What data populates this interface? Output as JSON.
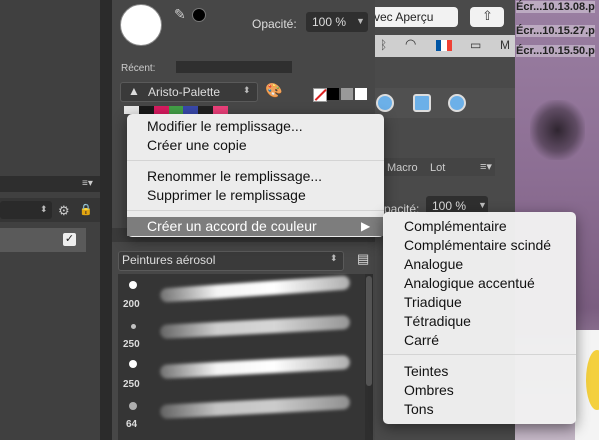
{
  "color_panel": {
    "opacity_label": "Opacité:",
    "opacity_value": "100 %",
    "recent_label": "Récent:",
    "palette_name": "Aristo-Palette",
    "palette_colors": [
      "#e8e8e8",
      "#1a1a1a",
      "#d81b60",
      "#43a047",
      "#3949ab",
      "#212121",
      "#ec407a"
    ]
  },
  "context_menu": {
    "items": [
      "Modifier le remplissage...",
      "Créer une copie",
      "Renommer le remplissage...",
      "Supprimer le remplissage",
      "Créer un accord de couleur"
    ]
  },
  "harmony_submenu": {
    "items": [
      "Complémentaire",
      "Complémentaire scindé",
      "Analogue",
      "Analogique accentué",
      "Triadique",
      "Tétradique",
      "Carré",
      "Teintes",
      "Ombres",
      "Tons"
    ]
  },
  "brushes": {
    "category": "Peintures aérosol",
    "sizes": [
      "200",
      "250",
      "250",
      "64"
    ]
  },
  "right_panel": {
    "preview_button": "vec Aperçu",
    "tabs": [
      "Macro",
      "Lot"
    ],
    "opacity_label": "pacité:",
    "opacity_value": "100 %"
  },
  "desktop": {
    "files": [
      "Écr...10.13.08.p",
      "Écr...10.15.27.p",
      "Écr...10.15.50.p"
    ]
  },
  "left_panel": {
    "layer_checked": "✓"
  }
}
